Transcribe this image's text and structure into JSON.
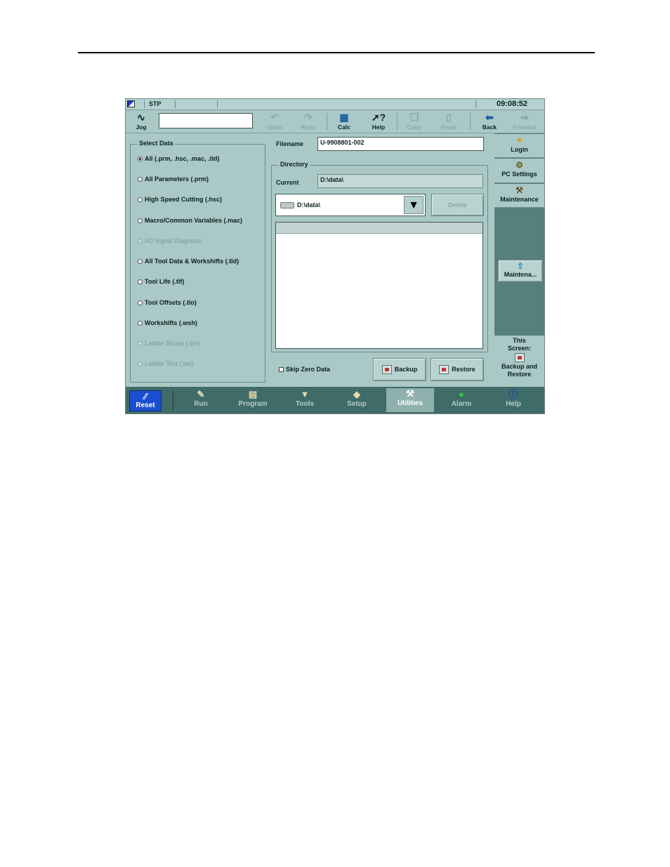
{
  "status": {
    "mode": "STP",
    "clock": "09:08:52"
  },
  "toolbar": {
    "jog": "Jog",
    "undo": "Undo",
    "redo": "Redo",
    "calc": "Calc",
    "help": "Help",
    "copy": "Copy",
    "paste": "Paste",
    "back": "Back",
    "forward": "Forward"
  },
  "select_data": {
    "title": "Select Data",
    "options": [
      {
        "label": "All (.prm, .hsc, .mac, .tld)",
        "selected": true,
        "enabled": true
      },
      {
        "label": "All Parameters (.prm)",
        "selected": false,
        "enabled": true
      },
      {
        "label": "High Speed Cutting (.hsc)",
        "selected": false,
        "enabled": true
      },
      {
        "label": "Macro/Common Variables (.mac)",
        "selected": false,
        "enabled": true
      },
      {
        "label": "I/O Signal Diagnosis",
        "selected": false,
        "enabled": false
      },
      {
        "label": "All Tool Data & Workshifts (.tld)",
        "selected": false,
        "enabled": true
      },
      {
        "label": "Tool Life (.tlf)",
        "selected": false,
        "enabled": true
      },
      {
        "label": "Tool Offsets (.tlo)",
        "selected": false,
        "enabled": true
      },
      {
        "label": "Workshifts (.wsh)",
        "selected": false,
        "enabled": true
      },
      {
        "label": "Ladder Binary (.bin)",
        "selected": false,
        "enabled": false
      },
      {
        "label": "Ladder Text (.lad)",
        "selected": false,
        "enabled": false
      }
    ]
  },
  "filename": {
    "label": "Filename",
    "value": "U-9908801-002"
  },
  "directory": {
    "title": "Directory",
    "current_label": "Current",
    "current_value": "D:\\data\\",
    "drive_value": "D:\\data\\",
    "delete_label": "Delete"
  },
  "skip_zero": {
    "label": "Skip Zero Data",
    "checked": false
  },
  "actions": {
    "backup": "Backup",
    "restore": "Restore"
  },
  "right_panel": {
    "login": "Login",
    "pc_settings": "PC Settings",
    "maintenance": "Maintenance",
    "mainten_button": "Maintena...",
    "this_screen_line1": "This",
    "this_screen_line2": "Screen:",
    "this_screen_line3": "Backup and",
    "this_screen_line4": "Restore"
  },
  "bottom_nav": {
    "reset": "Reset",
    "run": "Run",
    "program": "Program",
    "tools": "Tools",
    "setup": "Setup",
    "utilities": "Utilities",
    "alarm": "Alarm",
    "help": "Help",
    "active": "Utilities"
  },
  "colors": {
    "panel": "#a9c8c6",
    "bottom_bar": "#3f6c69",
    "reset": "#1a4fd1",
    "right_panel_bg": "#57807d"
  }
}
